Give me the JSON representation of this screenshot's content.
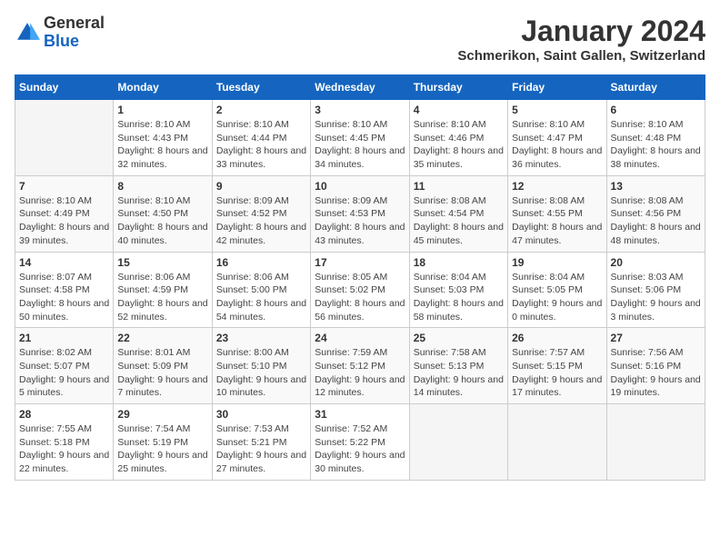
{
  "header": {
    "logo_line1": "General",
    "logo_line2": "Blue",
    "month": "January 2024",
    "location": "Schmerikon, Saint Gallen, Switzerland"
  },
  "weekdays": [
    "Sunday",
    "Monday",
    "Tuesday",
    "Wednesday",
    "Thursday",
    "Friday",
    "Saturday"
  ],
  "weeks": [
    [
      {
        "day": "",
        "empty": true
      },
      {
        "day": "1",
        "sunrise": "Sunrise: 8:10 AM",
        "sunset": "Sunset: 4:43 PM",
        "daylight": "Daylight: 8 hours and 32 minutes."
      },
      {
        "day": "2",
        "sunrise": "Sunrise: 8:10 AM",
        "sunset": "Sunset: 4:44 PM",
        "daylight": "Daylight: 8 hours and 33 minutes."
      },
      {
        "day": "3",
        "sunrise": "Sunrise: 8:10 AM",
        "sunset": "Sunset: 4:45 PM",
        "daylight": "Daylight: 8 hours and 34 minutes."
      },
      {
        "day": "4",
        "sunrise": "Sunrise: 8:10 AM",
        "sunset": "Sunset: 4:46 PM",
        "daylight": "Daylight: 8 hours and 35 minutes."
      },
      {
        "day": "5",
        "sunrise": "Sunrise: 8:10 AM",
        "sunset": "Sunset: 4:47 PM",
        "daylight": "Daylight: 8 hours and 36 minutes."
      },
      {
        "day": "6",
        "sunrise": "Sunrise: 8:10 AM",
        "sunset": "Sunset: 4:48 PM",
        "daylight": "Daylight: 8 hours and 38 minutes."
      }
    ],
    [
      {
        "day": "7",
        "sunrise": "Sunrise: 8:10 AM",
        "sunset": "Sunset: 4:49 PM",
        "daylight": "Daylight: 8 hours and 39 minutes."
      },
      {
        "day": "8",
        "sunrise": "Sunrise: 8:10 AM",
        "sunset": "Sunset: 4:50 PM",
        "daylight": "Daylight: 8 hours and 40 minutes."
      },
      {
        "day": "9",
        "sunrise": "Sunrise: 8:09 AM",
        "sunset": "Sunset: 4:52 PM",
        "daylight": "Daylight: 8 hours and 42 minutes."
      },
      {
        "day": "10",
        "sunrise": "Sunrise: 8:09 AM",
        "sunset": "Sunset: 4:53 PM",
        "daylight": "Daylight: 8 hours and 43 minutes."
      },
      {
        "day": "11",
        "sunrise": "Sunrise: 8:08 AM",
        "sunset": "Sunset: 4:54 PM",
        "daylight": "Daylight: 8 hours and 45 minutes."
      },
      {
        "day": "12",
        "sunrise": "Sunrise: 8:08 AM",
        "sunset": "Sunset: 4:55 PM",
        "daylight": "Daylight: 8 hours and 47 minutes."
      },
      {
        "day": "13",
        "sunrise": "Sunrise: 8:08 AM",
        "sunset": "Sunset: 4:56 PM",
        "daylight": "Daylight: 8 hours and 48 minutes."
      }
    ],
    [
      {
        "day": "14",
        "sunrise": "Sunrise: 8:07 AM",
        "sunset": "Sunset: 4:58 PM",
        "daylight": "Daylight: 8 hours and 50 minutes."
      },
      {
        "day": "15",
        "sunrise": "Sunrise: 8:06 AM",
        "sunset": "Sunset: 4:59 PM",
        "daylight": "Daylight: 8 hours and 52 minutes."
      },
      {
        "day": "16",
        "sunrise": "Sunrise: 8:06 AM",
        "sunset": "Sunset: 5:00 PM",
        "daylight": "Daylight: 8 hours and 54 minutes."
      },
      {
        "day": "17",
        "sunrise": "Sunrise: 8:05 AM",
        "sunset": "Sunset: 5:02 PM",
        "daylight": "Daylight: 8 hours and 56 minutes."
      },
      {
        "day": "18",
        "sunrise": "Sunrise: 8:04 AM",
        "sunset": "Sunset: 5:03 PM",
        "daylight": "Daylight: 8 hours and 58 minutes."
      },
      {
        "day": "19",
        "sunrise": "Sunrise: 8:04 AM",
        "sunset": "Sunset: 5:05 PM",
        "daylight": "Daylight: 9 hours and 0 minutes."
      },
      {
        "day": "20",
        "sunrise": "Sunrise: 8:03 AM",
        "sunset": "Sunset: 5:06 PM",
        "daylight": "Daylight: 9 hours and 3 minutes."
      }
    ],
    [
      {
        "day": "21",
        "sunrise": "Sunrise: 8:02 AM",
        "sunset": "Sunset: 5:07 PM",
        "daylight": "Daylight: 9 hours and 5 minutes."
      },
      {
        "day": "22",
        "sunrise": "Sunrise: 8:01 AM",
        "sunset": "Sunset: 5:09 PM",
        "daylight": "Daylight: 9 hours and 7 minutes."
      },
      {
        "day": "23",
        "sunrise": "Sunrise: 8:00 AM",
        "sunset": "Sunset: 5:10 PM",
        "daylight": "Daylight: 9 hours and 10 minutes."
      },
      {
        "day": "24",
        "sunrise": "Sunrise: 7:59 AM",
        "sunset": "Sunset: 5:12 PM",
        "daylight": "Daylight: 9 hours and 12 minutes."
      },
      {
        "day": "25",
        "sunrise": "Sunrise: 7:58 AM",
        "sunset": "Sunset: 5:13 PM",
        "daylight": "Daylight: 9 hours and 14 minutes."
      },
      {
        "day": "26",
        "sunrise": "Sunrise: 7:57 AM",
        "sunset": "Sunset: 5:15 PM",
        "daylight": "Daylight: 9 hours and 17 minutes."
      },
      {
        "day": "27",
        "sunrise": "Sunrise: 7:56 AM",
        "sunset": "Sunset: 5:16 PM",
        "daylight": "Daylight: 9 hours and 19 minutes."
      }
    ],
    [
      {
        "day": "28",
        "sunrise": "Sunrise: 7:55 AM",
        "sunset": "Sunset: 5:18 PM",
        "daylight": "Daylight: 9 hours and 22 minutes."
      },
      {
        "day": "29",
        "sunrise": "Sunrise: 7:54 AM",
        "sunset": "Sunset: 5:19 PM",
        "daylight": "Daylight: 9 hours and 25 minutes."
      },
      {
        "day": "30",
        "sunrise": "Sunrise: 7:53 AM",
        "sunset": "Sunset: 5:21 PM",
        "daylight": "Daylight: 9 hours and 27 minutes."
      },
      {
        "day": "31",
        "sunrise": "Sunrise: 7:52 AM",
        "sunset": "Sunset: 5:22 PM",
        "daylight": "Daylight: 9 hours and 30 minutes."
      },
      {
        "day": "",
        "empty": true
      },
      {
        "day": "",
        "empty": true
      },
      {
        "day": "",
        "empty": true
      }
    ]
  ]
}
